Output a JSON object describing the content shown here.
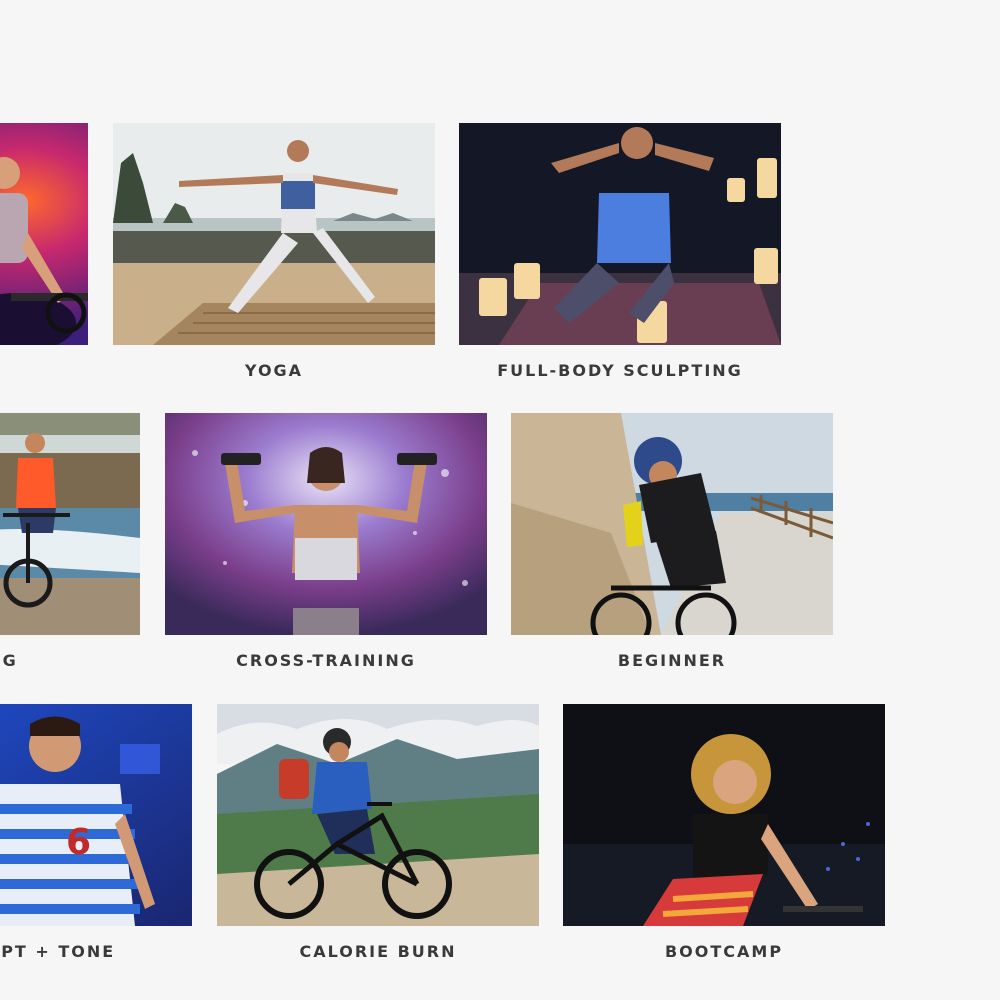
{
  "classes": [
    {
      "label": "",
      "image": "indoor-cycling-photo"
    },
    {
      "label": "YOGA",
      "image": "yoga-beach-photo"
    },
    {
      "label": "FULL-BODY SCULPTING",
      "image": "sculpting-candles-photo"
    },
    {
      "label": "YCLING",
      "image": "beach-cycling-photo"
    },
    {
      "label": "CROSS-TRAINING",
      "image": "dumbbells-photo"
    },
    {
      "label": "BEGINNER",
      "image": "road-cycling-photo"
    },
    {
      "label": "SCULPT + TONE",
      "image": "stage-cycling-photo"
    },
    {
      "label": "CALORIE BURN",
      "image": "mountain-bike-photo"
    },
    {
      "label": "BOOTCAMP",
      "image": "studio-cycling-photo"
    }
  ]
}
